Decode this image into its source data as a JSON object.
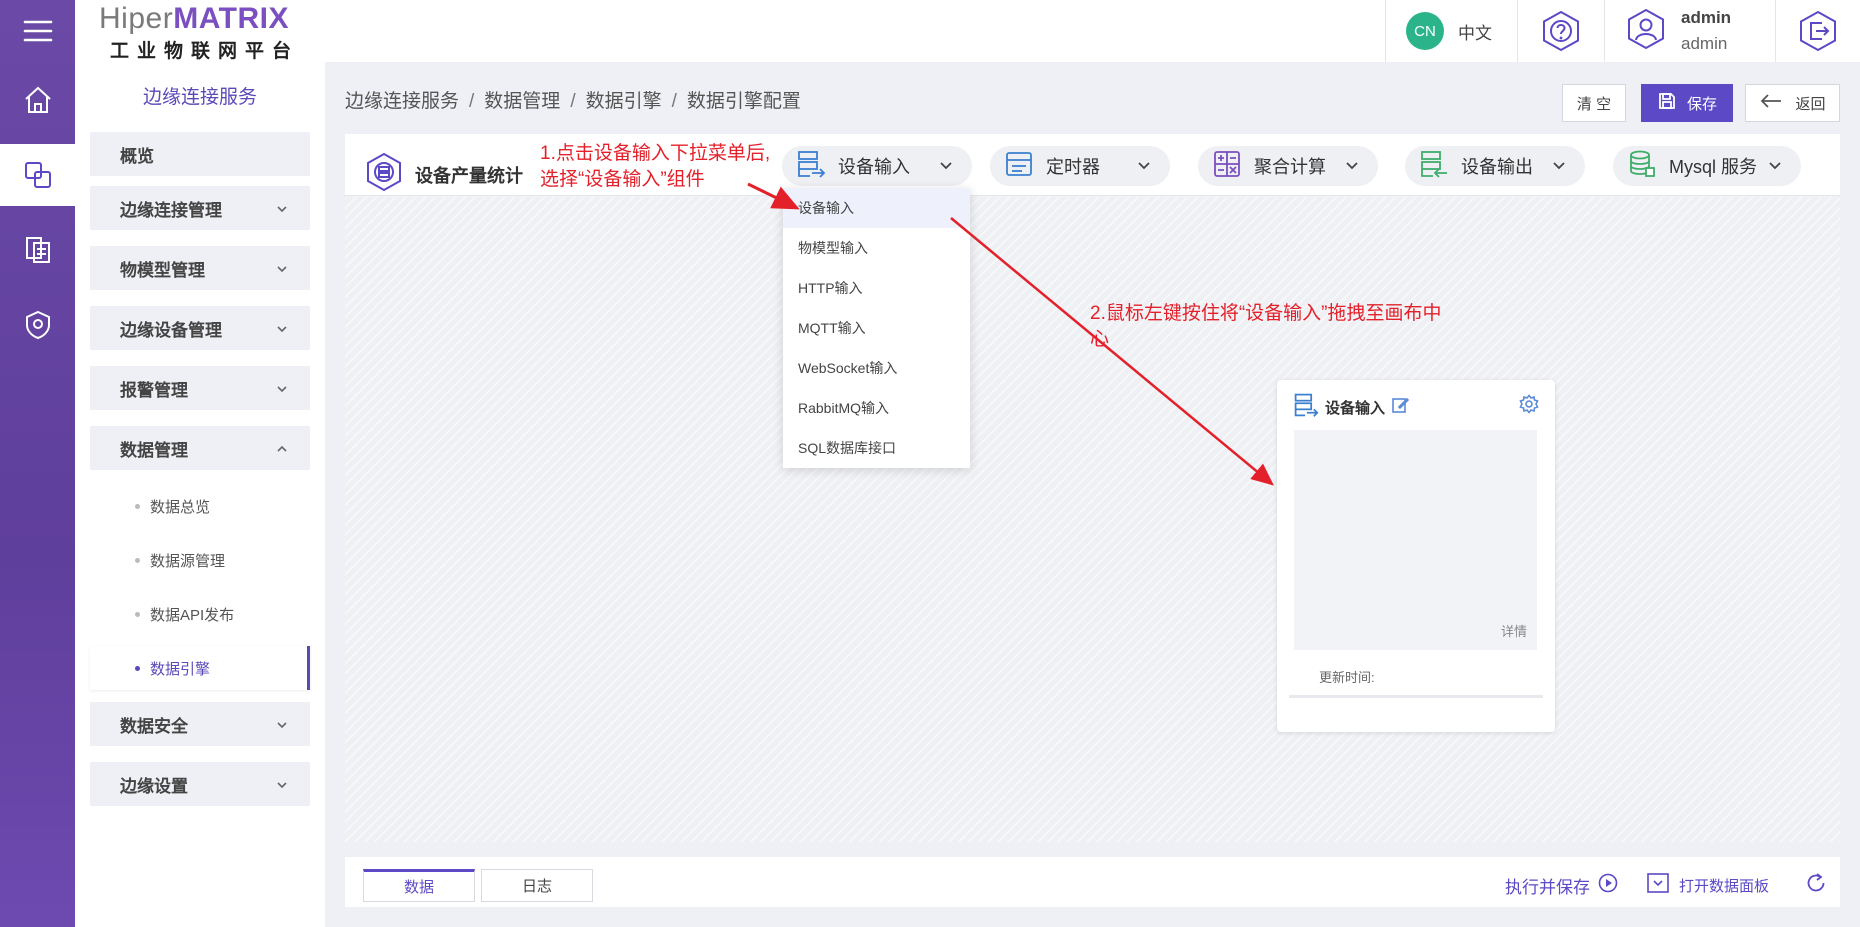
{
  "brand": {
    "name_part1": "Hiper",
    "name_part2": "MATRIX",
    "subtitle": "工业物联网平台"
  },
  "header": {
    "lang_badge": "CN",
    "lang_label": "中文",
    "user_name": "admin",
    "user_role": "admin"
  },
  "sidebar": {
    "title": "边缘连接服务",
    "items": [
      {
        "label": "概览"
      },
      {
        "label": "边缘连接管理"
      },
      {
        "label": "物模型管理"
      },
      {
        "label": "边缘设备管理"
      },
      {
        "label": "报警管理"
      },
      {
        "label": "数据管理"
      },
      {
        "label": "数据安全"
      },
      {
        "label": "边缘设置"
      }
    ],
    "sub_items": [
      {
        "label": "数据总览"
      },
      {
        "label": "数据源管理"
      },
      {
        "label": "数据API发布"
      },
      {
        "label": "数据引擎"
      }
    ]
  },
  "breadcrumb": [
    "边缘连接服务",
    "数据管理",
    "数据引擎",
    "数据引擎配置"
  ],
  "actions": {
    "clear": "清 空",
    "save": "保存",
    "back": "返回"
  },
  "toolbar": {
    "title": "设备产量统计",
    "dropdowns": [
      {
        "label": "设备输入",
        "icon": "device-input-icon"
      },
      {
        "label": "定时器",
        "icon": "timer-icon"
      },
      {
        "label": "聚合计算",
        "icon": "calculator-icon"
      },
      {
        "label": "设备输出",
        "icon": "device-output-icon"
      },
      {
        "label": "Mysql 服务",
        "icon": "database-icon"
      }
    ]
  },
  "dropdown_menu": {
    "items": [
      "设备输入",
      "物模型输入",
      "HTTP输入",
      "MQTT输入",
      "WebSocket输入",
      "RabbitMQ输入",
      "SQL数据库接口"
    ],
    "highlighted": "设备输入"
  },
  "node": {
    "title": "设备输入",
    "detail": "详情",
    "update_time_label": "更新时间:"
  },
  "annotations": {
    "step1_line1": "1.点击设备输入下拉菜单后,",
    "step1_line2": "选择“设备输入”组件",
    "step2_line1": "2.鼠标左键按住将“设备输入”拖拽至画布中",
    "step2_line2": "心"
  },
  "bottom": {
    "tabs": [
      "数据",
      "日志"
    ],
    "run_save": "执行并保存",
    "open_panel": "打开数据面板"
  },
  "colors": {
    "accent": "#5b49c6",
    "rail": "#6a4aa6",
    "annotation": "#e4202a",
    "lang_badge": "#2bb48a"
  }
}
